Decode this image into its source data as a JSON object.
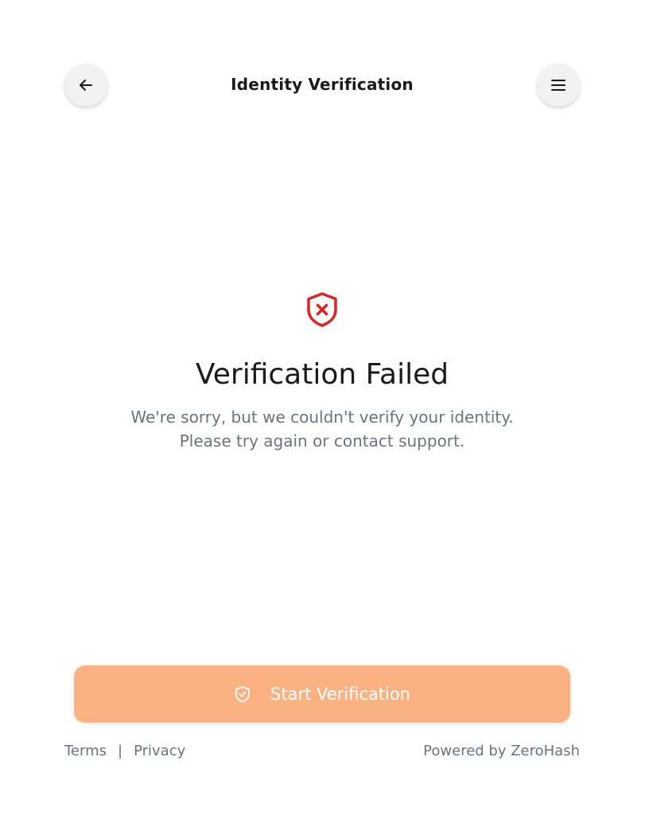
{
  "header": {
    "title": "Identity Verification",
    "back_icon": "arrow-left-icon",
    "menu_icon": "hamburger-menu-icon"
  },
  "status": {
    "icon": "shield-x-icon",
    "icon_color": "#dc2626",
    "title": "Verification Failed",
    "message": "We're sorry, but we couldn't verify your identity. Please try again or contact support."
  },
  "cta": {
    "label": "Start Verification",
    "icon": "shield-check-icon",
    "background": "#fbb283",
    "text_color": "#ffffff"
  },
  "footer": {
    "terms_label": "Terms",
    "separator": "|",
    "privacy_label": "Privacy",
    "powered_by": "Powered by ZeroHash"
  }
}
